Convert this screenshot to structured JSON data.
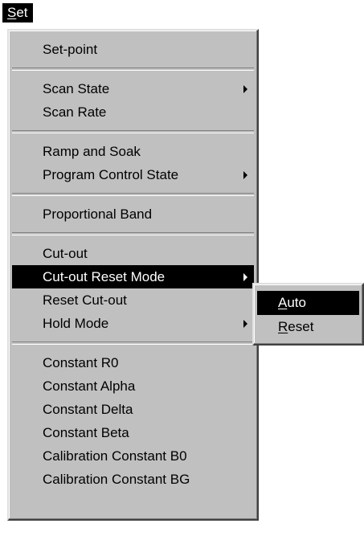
{
  "menubar": {
    "title": "Set",
    "title_mnemonic": "S",
    "title_rest": "et"
  },
  "menu": {
    "items": [
      {
        "label": "Set-point"
      },
      {
        "separator": true
      },
      {
        "label": "Scan State",
        "submenu": true
      },
      {
        "label": "Scan Rate"
      },
      {
        "separator": true
      },
      {
        "label": "Ramp and Soak"
      },
      {
        "label": "Program Control State",
        "submenu": true
      },
      {
        "separator": true
      },
      {
        "label": "Proportional Band"
      },
      {
        "separator": true
      },
      {
        "label": "Cut-out"
      },
      {
        "label": "Cut-out Reset Mode",
        "submenu": true,
        "selected": true
      },
      {
        "label": "Reset Cut-out"
      },
      {
        "label": "Hold Mode",
        "submenu": true
      },
      {
        "separator": true
      },
      {
        "label": "Constant R0"
      },
      {
        "label": "Constant Alpha"
      },
      {
        "label": "Constant Delta"
      },
      {
        "label": "Constant Beta"
      },
      {
        "label": "Calibration Constant B0"
      },
      {
        "label": "Calibration Constant BG"
      }
    ]
  },
  "submenu": {
    "parent": "Cut-out Reset Mode",
    "items": [
      {
        "label": "Auto",
        "mnemonic": "A",
        "rest": "uto",
        "selected": true
      },
      {
        "label": "Reset",
        "mnemonic": "R",
        "rest": "eset"
      }
    ]
  },
  "colors": {
    "menu_background": "#c0c0c0",
    "highlight": "#000000",
    "highlight_text": "#ffffff"
  }
}
